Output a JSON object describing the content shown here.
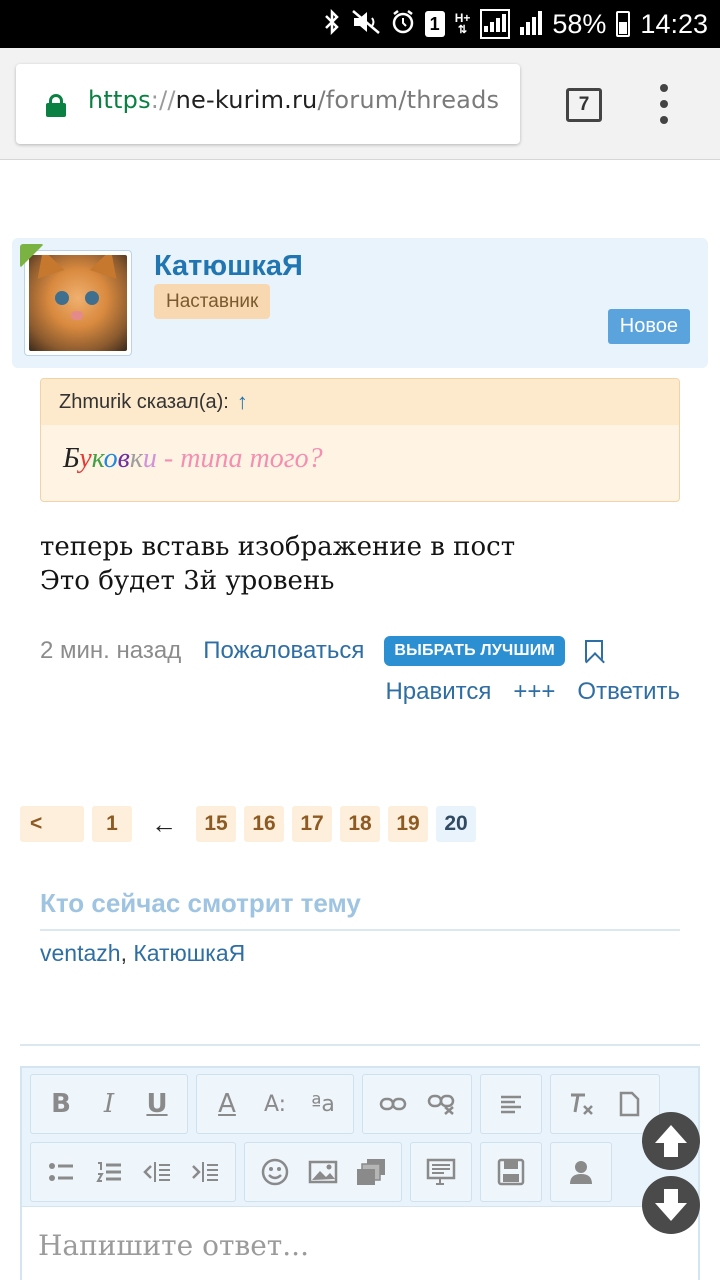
{
  "status_bar": {
    "battery": "58%",
    "time": "14:23",
    "network_type": "H+",
    "sim_slot": "1",
    "icons": [
      "bluetooth-icon",
      "mute-icon",
      "alarm-icon",
      "sim-icon",
      "signal-icon",
      "signal-icon",
      "battery-icon"
    ]
  },
  "browser": {
    "url_scheme": "https",
    "url_sep": "://",
    "url_host": "ne-kurim.ru",
    "url_path": "/forum/threads",
    "tab_count": "7",
    "secure_color": "#0b8043"
  },
  "post": {
    "author": "КатюшкаЯ",
    "role": "Наставник",
    "new_badge": "Новое",
    "quote": {
      "author_line": "Zhmurik сказал(а):",
      "arrow": "↑",
      "text_tail": " - типа того?"
    },
    "body_lines": [
      "теперь вставь изображение в пост",
      "Это будет 3й уровень"
    ],
    "time": "2 мин. назад",
    "report": "Пожаловаться",
    "best_button": "ВЫБРАТЬ ЛУЧШИМ",
    "actions": {
      "like": "Нравится",
      "plus": "+++",
      "reply": "Ответить"
    }
  },
  "pagination": {
    "prev": "<",
    "first": "1",
    "gap": "←",
    "pages": [
      "15",
      "16",
      "17",
      "18",
      "19"
    ],
    "current": "20"
  },
  "viewing": {
    "title": "Кто сейчас смотрит тему",
    "users": [
      "ventazh",
      "КатюшкаЯ"
    ],
    "separator": ", "
  },
  "editor": {
    "placeholder": "Напишите ответ...",
    "toolbar_row1": [
      "B",
      "I",
      "U",
      "A",
      "A:",
      "ªa"
    ],
    "toolbar_row2": [
      "list-bullet-icon",
      "list-number-icon",
      "outdent-icon",
      "indent-icon",
      "smiley-icon",
      "image-icon",
      "media-icon",
      "quote-icon",
      "save-icon",
      "user-icon"
    ]
  },
  "colors": {
    "link": "#2f6ea3",
    "accent_blue": "#2b8fd1",
    "quote_bg": "#fff4e4",
    "post_header_bg": "#e9f3fb"
  }
}
